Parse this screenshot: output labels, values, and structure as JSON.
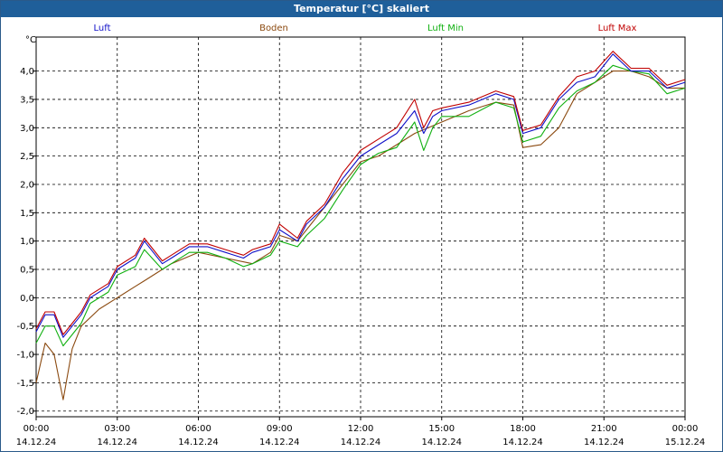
{
  "window": {
    "title": "Temperatur [°C] skaliert"
  },
  "colors": {
    "titlebar": "#1f5f9a",
    "luft": "#1010c8",
    "boden": "#8b4a10",
    "luft_min": "#10b010",
    "luft_max": "#c00000"
  },
  "chart_data": {
    "type": "line",
    "title": "Temperatur [°C] skaliert",
    "ylabel": "°C",
    "xlabel": "",
    "ylim": [
      -2.1,
      4.6
    ],
    "xlim": [
      "14.12.24 00:00",
      "15.12.24 00:00"
    ],
    "grid": true,
    "legend_position": "top",
    "x_ticks": [
      {
        "time": "00:00",
        "date": "14.12.24"
      },
      {
        "time": "03:00",
        "date": "14.12.24"
      },
      {
        "time": "06:00",
        "date": "14.12.24"
      },
      {
        "time": "09:00",
        "date": "14.12.24"
      },
      {
        "time": "12:00",
        "date": "14.12.24"
      },
      {
        "time": "15:00",
        "date": "14.12.24"
      },
      {
        "time": "18:00",
        "date": "14.12.24"
      },
      {
        "time": "21:00",
        "date": "14.12.24"
      },
      {
        "time": "00:00",
        "date": "15.12.24"
      }
    ],
    "y_ticks": [
      "4,0",
      "3,5",
      "3,0",
      "2,5",
      "2,0",
      "1,5",
      "1,0",
      "0,5",
      "0,0",
      "-0,5",
      "-1,0",
      "-1,5",
      "-2,0"
    ],
    "y_tick_values": [
      4.0,
      3.5,
      3.0,
      2.5,
      2.0,
      1.5,
      1.0,
      0.5,
      0.0,
      -0.5,
      -1.0,
      -1.5,
      -2.0
    ],
    "series": [
      {
        "name": "Luft",
        "color": "#1010c8",
        "x": [
          "14.12.24 00:00",
          "14.12.24 00:20",
          "14.12.24 00:40",
          "14.12.24 01:00",
          "14.12.24 01:20",
          "14.12.24 01:40",
          "14.12.24 02:00",
          "14.12.24 02:40",
          "14.12.24 03:00",
          "14.12.24 03:40",
          "14.12.24 04:00",
          "14.12.24 04:40",
          "14.12.24 05:00",
          "14.12.24 05:40",
          "14.12.24 06:20",
          "14.12.24 07:00",
          "14.12.24 07:40",
          "14.12.24 08:00",
          "14.12.24 08:40",
          "14.12.24 09:00",
          "14.12.24 09:40",
          "14.12.24 10:00",
          "14.12.24 10:40",
          "14.12.24 11:20",
          "14.12.24 12:00",
          "14.12.24 12:40",
          "14.12.24 13:20",
          "14.12.24 14:00",
          "14.12.24 14:20",
          "14.12.24 14:40",
          "14.12.24 15:00",
          "14.12.24 16:00",
          "14.12.24 17:00",
          "14.12.24 17:40",
          "14.12.24 18:00",
          "14.12.24 18:40",
          "14.12.24 19:20",
          "14.12.24 20:00",
          "14.12.24 20:40",
          "14.12.24 21:20",
          "14.12.24 22:00",
          "14.12.24 22:40",
          "14.12.24 23:20",
          "15.12.24 00:00"
        ],
        "values": [
          -0.6,
          -0.3,
          -0.3,
          -0.7,
          -0.5,
          -0.3,
          0.0,
          0.2,
          0.5,
          0.7,
          1.0,
          0.6,
          0.7,
          0.9,
          0.9,
          0.8,
          0.7,
          0.8,
          0.9,
          1.2,
          1.0,
          1.3,
          1.6,
          2.1,
          2.5,
          2.7,
          2.9,
          3.3,
          2.9,
          3.2,
          3.3,
          3.4,
          3.6,
          3.5,
          2.9,
          3.0,
          3.5,
          3.8,
          3.9,
          4.3,
          4.0,
          4.0,
          3.7,
          3.8
        ]
      },
      {
        "name": "Boden",
        "color": "#8b4a10",
        "x": [
          "14.12.24 00:00",
          "14.12.24 00:20",
          "14.12.24 00:40",
          "14.12.24 01:00",
          "14.12.24 01:20",
          "14.12.24 01:40",
          "14.12.24 02:20",
          "14.12.24 03:00",
          "14.12.24 03:40",
          "14.12.24 04:00",
          "14.12.24 04:40",
          "14.12.24 05:00",
          "14.12.24 06:00",
          "14.12.24 07:00",
          "14.12.24 08:00",
          "14.12.24 08:40",
          "14.12.24 09:00",
          "14.12.24 09:40",
          "14.12.24 10:00",
          "14.12.24 10:40",
          "14.12.24 11:20",
          "14.12.24 12:00",
          "14.12.24 12:40",
          "14.12.24 13:20",
          "14.12.24 14:00",
          "14.12.24 15:00",
          "14.12.24 16:00",
          "14.12.24 17:00",
          "14.12.24 17:40",
          "14.12.24 18:00",
          "14.12.24 18:40",
          "14.12.24 19:20",
          "14.12.24 20:00",
          "14.12.24 20:40",
          "14.12.24 21:20",
          "14.12.24 22:00",
          "14.12.24 22:40",
          "14.12.24 23:20",
          "15.12.24 00:00"
        ],
        "values": [
          -1.5,
          -0.8,
          -1.0,
          -1.8,
          -0.9,
          -0.5,
          -0.2,
          0.0,
          0.2,
          0.3,
          0.5,
          0.6,
          0.8,
          0.7,
          0.6,
          0.8,
          1.1,
          1.0,
          1.2,
          1.6,
          2.0,
          2.4,
          2.5,
          2.7,
          2.9,
          3.1,
          3.3,
          3.45,
          3.4,
          2.65,
          2.7,
          3.0,
          3.6,
          3.8,
          4.0,
          4.0,
          3.9,
          3.7,
          3.7
        ]
      },
      {
        "name": "Luft Min",
        "color": "#10b010",
        "x": [
          "14.12.24 00:00",
          "14.12.24 00:20",
          "14.12.24 00:40",
          "14.12.24 01:00",
          "14.12.24 01:20",
          "14.12.24 01:40",
          "14.12.24 02:00",
          "14.12.24 02:40",
          "14.12.24 03:00",
          "14.12.24 03:40",
          "14.12.24 04:00",
          "14.12.24 04:40",
          "14.12.24 05:00",
          "14.12.24 05:40",
          "14.12.24 06:20",
          "14.12.24 07:00",
          "14.12.24 07:40",
          "14.12.24 08:00",
          "14.12.24 08:40",
          "14.12.24 09:00",
          "14.12.24 09:40",
          "14.12.24 10:00",
          "14.12.24 10:40",
          "14.12.24 11:20",
          "14.12.24 12:00",
          "14.12.24 12:40",
          "14.12.24 13:20",
          "14.12.24 14:00",
          "14.12.24 14:20",
          "14.12.24 14:40",
          "14.12.24 15:00",
          "14.12.24 16:00",
          "14.12.24 17:00",
          "14.12.24 17:40",
          "14.12.24 18:00",
          "14.12.24 18:40",
          "14.12.24 19:20",
          "14.12.24 20:00",
          "14.12.24 20:40",
          "14.12.24 21:20",
          "14.12.24 22:00",
          "14.12.24 22:40",
          "14.12.24 23:20",
          "15.12.24 00:00"
        ],
        "values": [
          -0.8,
          -0.5,
          -0.5,
          -0.85,
          -0.65,
          -0.45,
          -0.1,
          0.1,
          0.4,
          0.55,
          0.85,
          0.5,
          0.6,
          0.8,
          0.8,
          0.7,
          0.55,
          0.6,
          0.75,
          1.0,
          0.9,
          1.1,
          1.4,
          1.9,
          2.35,
          2.55,
          2.65,
          3.1,
          2.6,
          3.0,
          3.2,
          3.2,
          3.45,
          3.35,
          2.75,
          2.85,
          3.35,
          3.65,
          3.8,
          4.1,
          4.0,
          3.95,
          3.6,
          3.7
        ]
      },
      {
        "name": "Luft Max",
        "color": "#c00000",
        "x": [
          "14.12.24 00:00",
          "14.12.24 00:20",
          "14.12.24 00:40",
          "14.12.24 01:00",
          "14.12.24 01:20",
          "14.12.24 01:40",
          "14.12.24 02:00",
          "14.12.24 02:40",
          "14.12.24 03:00",
          "14.12.24 03:40",
          "14.12.24 04:00",
          "14.12.24 04:40",
          "14.12.24 05:00",
          "14.12.24 05:40",
          "14.12.24 06:20",
          "14.12.24 07:00",
          "14.12.24 07:40",
          "14.12.24 08:00",
          "14.12.24 08:40",
          "14.12.24 09:00",
          "14.12.24 09:40",
          "14.12.24 10:00",
          "14.12.24 10:40",
          "14.12.24 11:20",
          "14.12.24 12:00",
          "14.12.24 12:40",
          "14.12.24 13:20",
          "14.12.24 14:00",
          "14.12.24 14:20",
          "14.12.24 14:40",
          "14.12.24 15:00",
          "14.12.24 16:00",
          "14.12.24 17:00",
          "14.12.24 17:40",
          "14.12.24 18:00",
          "14.12.24 18:40",
          "14.12.24 19:20",
          "14.12.24 20:00",
          "14.12.24 20:40",
          "14.12.24 21:20",
          "14.12.24 22:00",
          "14.12.24 22:40",
          "14.12.24 23:20",
          "15.12.24 00:00"
        ],
        "values": [
          -0.55,
          -0.25,
          -0.25,
          -0.65,
          -0.45,
          -0.25,
          0.05,
          0.25,
          0.55,
          0.75,
          1.05,
          0.65,
          0.75,
          0.95,
          0.95,
          0.85,
          0.75,
          0.85,
          0.95,
          1.3,
          1.05,
          1.35,
          1.65,
          2.2,
          2.6,
          2.8,
          3.0,
          3.5,
          3.0,
          3.3,
          3.35,
          3.45,
          3.65,
          3.55,
          2.95,
          3.05,
          3.55,
          3.9,
          4.0,
          4.35,
          4.05,
          4.05,
          3.75,
          3.85
        ]
      }
    ]
  }
}
